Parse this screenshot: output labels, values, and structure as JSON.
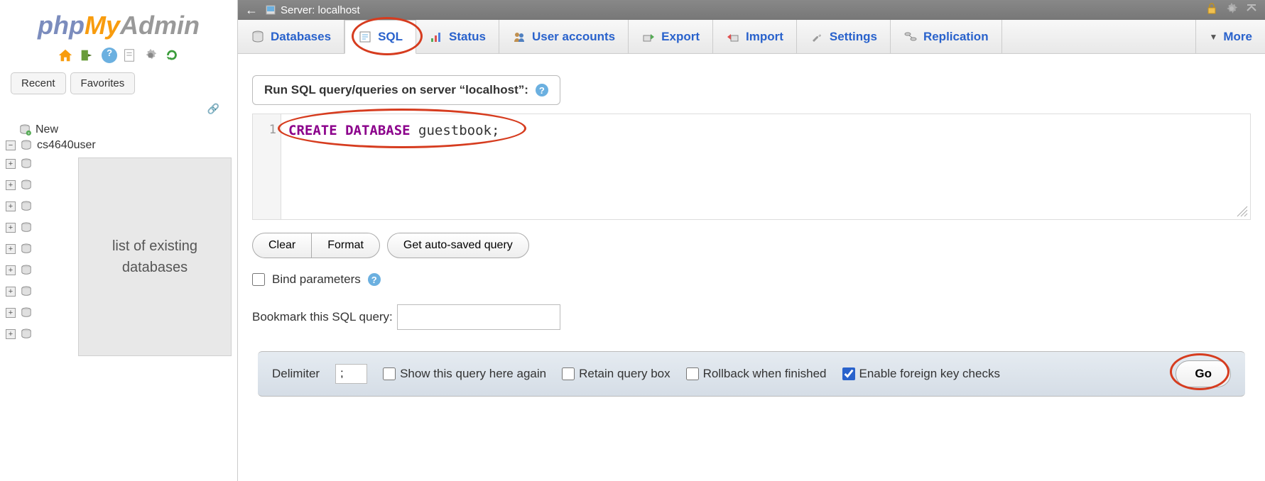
{
  "sidebar": {
    "logo": {
      "php": "php",
      "my": "My",
      "admin": "Admin"
    },
    "tabs": {
      "recent": "Recent",
      "favorites": "Favorites"
    },
    "tree": {
      "new": "New",
      "db1": "cs4640user",
      "placeholder": "list of existing databases"
    }
  },
  "breadcrumb": {
    "text": "Server: localhost"
  },
  "topTabs": {
    "databases": "Databases",
    "sql": "SQL",
    "status": "Status",
    "users": "User accounts",
    "export": "Export",
    "import": "Import",
    "settings": "Settings",
    "replication": "Replication",
    "more": "More"
  },
  "query": {
    "header": "Run SQL query/queries on server “localhost”:",
    "lineNum": "1",
    "sqlKeyword": "CREATE DATABASE",
    "sqlRest": " guestbook;",
    "clear": "Clear",
    "format": "Format",
    "autosaved": "Get auto-saved query",
    "bindParams": "Bind parameters",
    "bookmarkLabel": "Bookmark this SQL query:"
  },
  "footer": {
    "delimiterLabel": "Delimiter",
    "delimiterValue": ";",
    "showAgain": "Show this query here again",
    "retain": "Retain query box",
    "rollback": "Rollback when finished",
    "fk": "Enable foreign key checks",
    "go": "Go"
  }
}
